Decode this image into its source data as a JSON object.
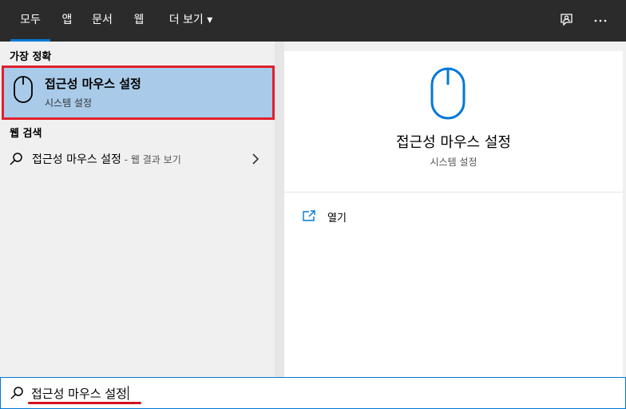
{
  "tabs": [
    {
      "label": "모두",
      "active": true
    },
    {
      "label": "앱"
    },
    {
      "label": "문서"
    },
    {
      "label": "웹"
    },
    {
      "label": "더 보기"
    }
  ],
  "more_caret": "▾",
  "icons": {
    "feedback": "feedback-icon",
    "more": "more-options-icon",
    "mouse": "mouse-icon",
    "search": "search-icon",
    "open": "open-icon",
    "chevron": "chevron-right-icon"
  },
  "best_match": {
    "section_title": "가장 정확",
    "title": "접근성 마우스 설정",
    "subtitle": "시스템 설정"
  },
  "web_search": {
    "section_title": "웹 검색",
    "query": "접근성 마우스 설정",
    "suffix": " - 웹 결과 보기"
  },
  "detail": {
    "title": "접근성 마우스 설정",
    "subtitle": "시스템 설정",
    "open_label": "열기"
  },
  "search": {
    "value": "접근성 마우스 설정"
  },
  "colors": {
    "accent": "#0078d7",
    "highlight": "#a9cbe9",
    "annotation_red": "#e0202c",
    "topbar": "#2b2b2b"
  }
}
